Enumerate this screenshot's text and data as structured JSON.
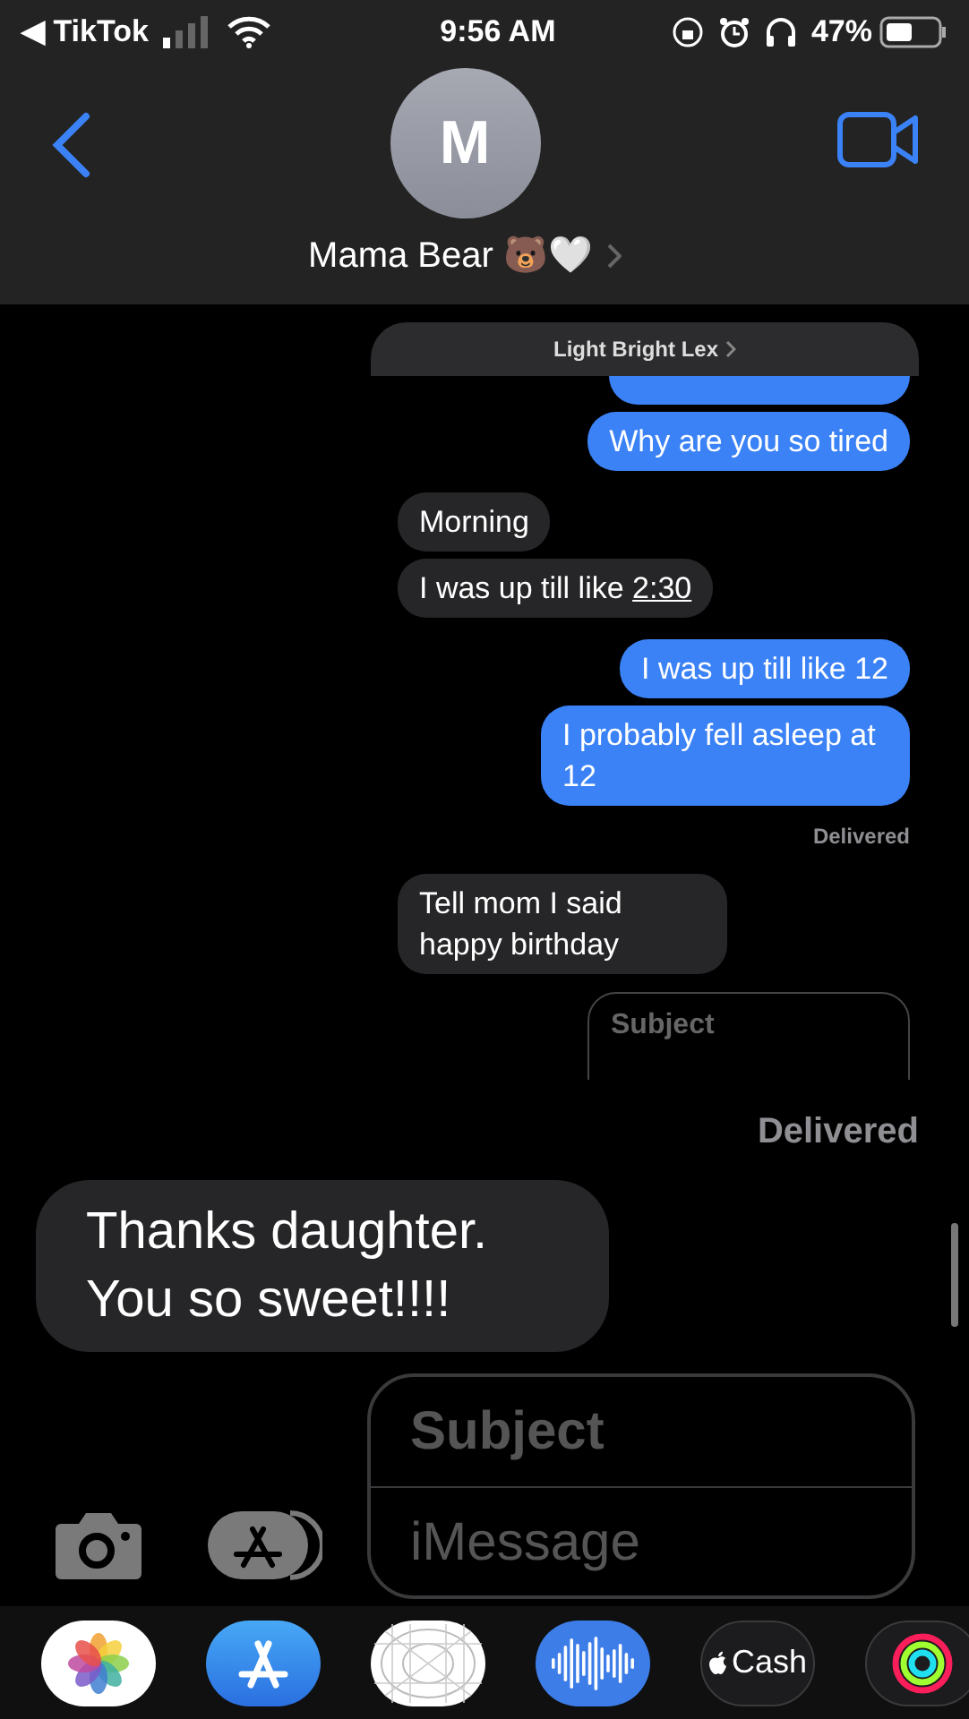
{
  "status_bar": {
    "back_glyph": "◀",
    "back_app": "TikTok",
    "time": "9:56 AM",
    "battery_percent": "47%"
  },
  "header": {
    "avatar_letter": "M",
    "contact_name": "Mama Bear 🐻🤍"
  },
  "shared_screenshot": {
    "banner": "Light Bright Lex",
    "messages": [
      {
        "kind": "fragment"
      },
      {
        "kind": "sent",
        "parts": [
          {
            "text": "Why are you so tired",
            "link": false
          }
        ]
      },
      {
        "kind": "received",
        "parts": [
          {
            "text": "Morning",
            "link": false
          }
        ]
      },
      {
        "kind": "received",
        "parts": [
          {
            "text": "I was up till like ",
            "link": false
          },
          {
            "text": "2:30",
            "link": true
          }
        ]
      },
      {
        "kind": "sent",
        "parts": [
          {
            "text": "I was up till like 12",
            "link": false
          }
        ]
      },
      {
        "kind": "sent",
        "parts": [
          {
            "text": "I probably fell asleep at 12",
            "link": false
          }
        ]
      },
      {
        "kind": "status",
        "text": "Delivered"
      },
      {
        "kind": "received",
        "parts": [
          {
            "text": "Tell mom I said happy birthday",
            "link": false
          }
        ]
      }
    ],
    "subject_placeholder": "Subject"
  },
  "conversation": {
    "receipt": "Delivered",
    "messages": [
      {
        "kind": "received",
        "text": "Thanks daughter. You so sweet!!!!"
      }
    ]
  },
  "composer": {
    "subject_placeholder": "Subject",
    "message_placeholder": "iMessage"
  },
  "app_drawer": {
    "cash_label": "Cash"
  }
}
